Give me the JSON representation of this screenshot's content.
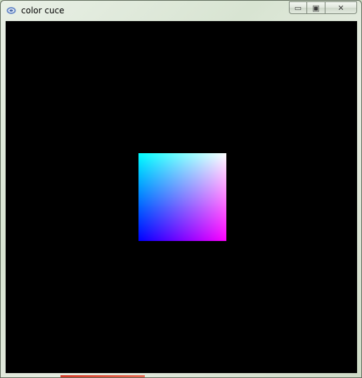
{
  "window": {
    "title": "color cuce",
    "icon": "app-icon"
  },
  "controls": {
    "minimize_icon": "minimize-icon",
    "maximize_icon": "maximize-icon",
    "close_icon": "close-icon",
    "minimize_glyph": "▭",
    "maximize_glyph": "▣",
    "close_glyph": "✕"
  },
  "canvas": {
    "background": "#000000",
    "cube_colors": {
      "top_left": "#00ffff",
      "top_right": "#ffffff",
      "bottom_left": "#0000ff",
      "bottom_right": "#ff00ff"
    }
  }
}
